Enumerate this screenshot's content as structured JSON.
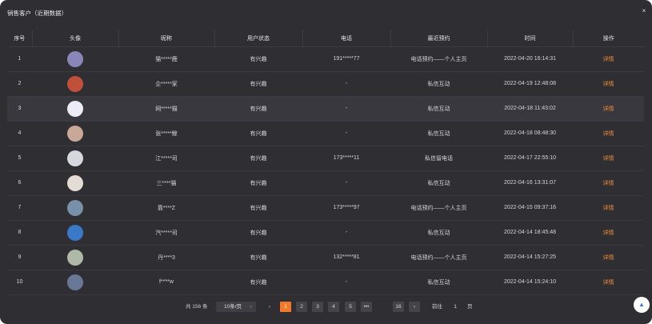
{
  "header": {
    "title": "销售客户（近期数据）",
    "close_glyph": "×"
  },
  "colors": {
    "background": "#2e2e33",
    "accent": "#f07a2a",
    "detail_link": "#f28c3a"
  },
  "table": {
    "columns": [
      "序号",
      "头像",
      "昵称",
      "用户状态",
      "电话",
      "最近预约",
      "时间",
      "操作"
    ],
    "rows": [
      {
        "index": "1",
        "avatar_color": "#8a86b8",
        "nickname": "猫*****鹿",
        "status": "有兴趣",
        "phone": "191*****77",
        "appointment": "电话预约——个人主页",
        "time": "2022-04-20 16:14:31",
        "action": "详情"
      },
      {
        "index": "2",
        "avatar_color": "#c0503a",
        "nickname": "企*****家",
        "status": "有兴趣",
        "phone": "-",
        "appointment": "私信互动",
        "time": "2022-04-19 12:48:08",
        "action": "详情"
      },
      {
        "index": "3",
        "avatar_color": "#ecebf6",
        "nickname": "网*****猫",
        "status": "有兴趣",
        "phone": "-",
        "appointment": "私信互动",
        "time": "2022-04-18 11:43:02",
        "action": "详情"
      },
      {
        "index": "4",
        "avatar_color": "#c9a89a",
        "nickname": "张*****鲸",
        "status": "有兴趣",
        "phone": "-",
        "appointment": "私信互动",
        "time": "2022-04-18 08:48:30",
        "action": "详情"
      },
      {
        "index": "5",
        "avatar_color": "#d7d7e0",
        "nickname": "江*****司",
        "status": "有兴趣",
        "phone": "173*****11",
        "appointment": "私信留电话",
        "time": "2022-04-17 22:55:10",
        "action": "详情"
      },
      {
        "index": "6",
        "avatar_color": "#e4dcd4",
        "nickname": "三****猫",
        "status": "有兴趣",
        "phone": "-",
        "appointment": "私信互动",
        "time": "2022-04-16 13:31:07",
        "action": "详情"
      },
      {
        "index": "7",
        "avatar_color": "#7890a8",
        "nickname": "靠****Z",
        "status": "有兴趣",
        "phone": "173*****97",
        "appointment": "电话预约——个人主页",
        "time": "2022-04-15 09:37:16",
        "action": "详情"
      },
      {
        "index": "8",
        "avatar_color": "#3a78c8",
        "nickname": "汽*****司",
        "status": "有兴趣",
        "phone": "-",
        "appointment": "私信互动",
        "time": "2022-04-14 18:45:48",
        "action": "详情"
      },
      {
        "index": "9",
        "avatar_color": "#b0b8a8",
        "nickname": "丹****3",
        "status": "有兴趣",
        "phone": "132*****81",
        "appointment": "电话预约——个人主页",
        "time": "2022-04-14 15:27:25",
        "action": "详情"
      },
      {
        "index": "10",
        "avatar_color": "#6a7898",
        "nickname": "f****w",
        "status": "有兴趣",
        "phone": "-",
        "appointment": "私信互动",
        "time": "2022-04-14 15:24:10",
        "action": "详情"
      }
    ]
  },
  "pagination": {
    "total": "共 156 条",
    "page_size": "10条/页",
    "prev": "‹",
    "pages": [
      "1",
      "2",
      "3",
      "4",
      "5",
      "•••",
      "16"
    ],
    "current": "1",
    "next": "›",
    "goto_label": "前往",
    "goto_value": "1",
    "page_unit": "页"
  },
  "fab": {
    "icon": "▲"
  }
}
